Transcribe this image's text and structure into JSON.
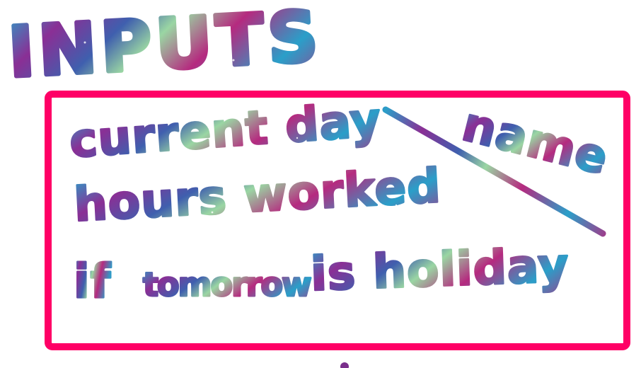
{
  "title": "INPUTS",
  "box_color": "#ff0066",
  "lines": {
    "line1": "current day",
    "line1_annotation": "name",
    "line2": "hours worked",
    "line3_part1": "if",
    "line3_part2": "tomorrow",
    "line3_part3": "is holiday"
  },
  "galaxy_colors": [
    "#2a9fc9",
    "#8a2f95",
    "#b52a7f",
    "#9ad6a3",
    "#3f5fae"
  ]
}
